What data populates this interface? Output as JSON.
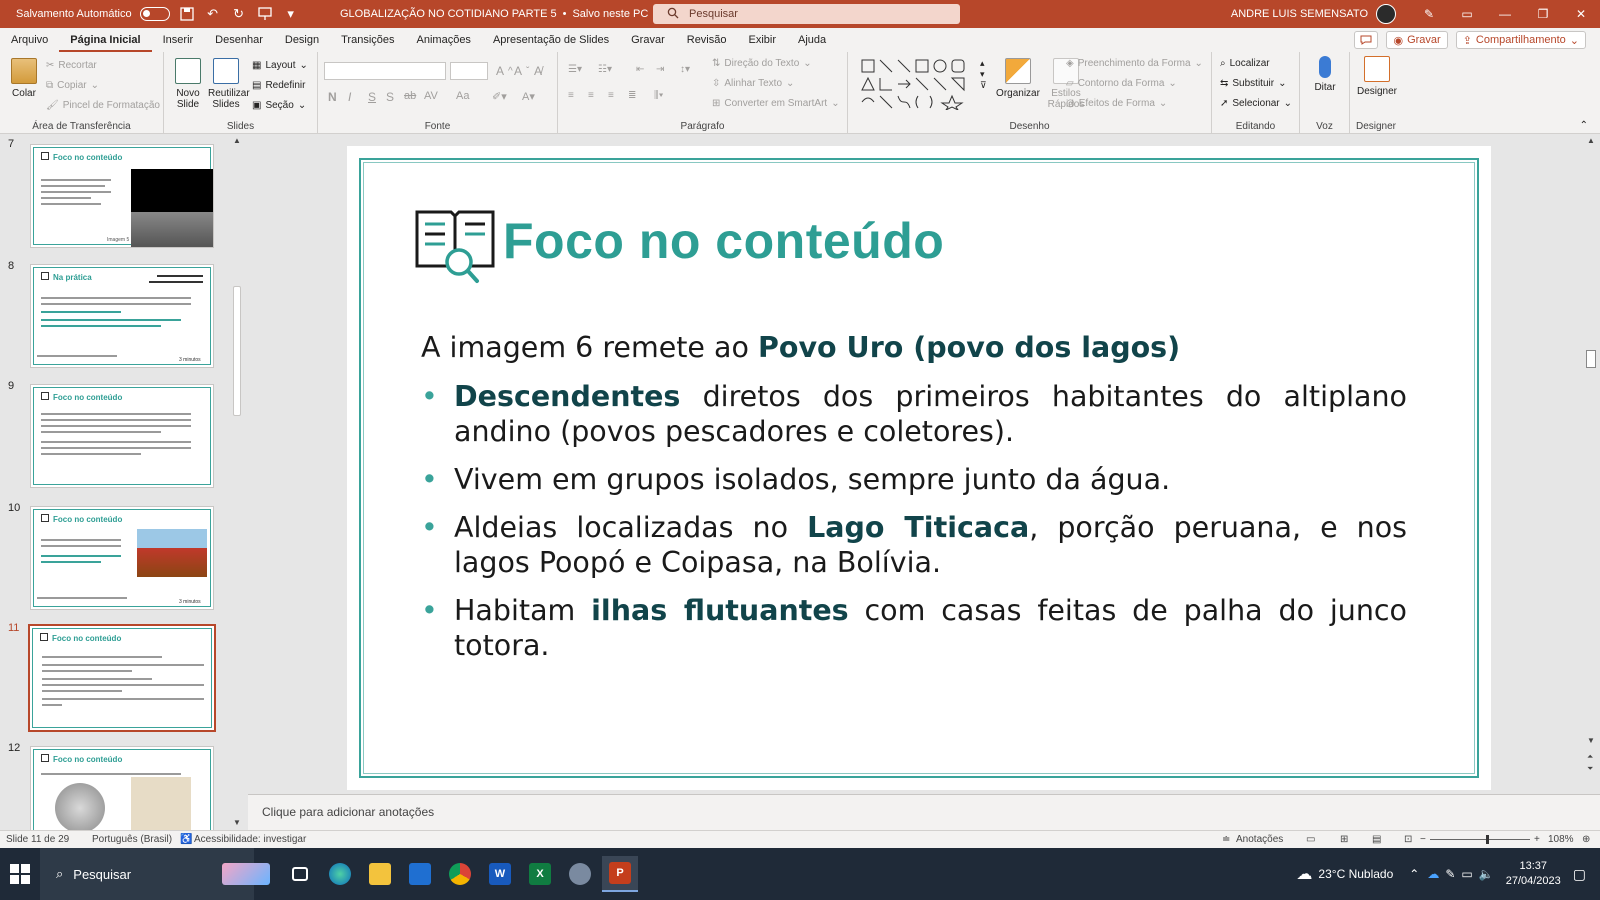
{
  "window": {
    "autosave_label": "Salvamento Automático",
    "doc_title": "GLOBALIZAÇÃO NO COTIDIANO PARTE 5",
    "save_status": "Salvo neste PC",
    "search_placeholder": "Pesquisar",
    "user_name": "ANDRE LUIS SEMENSATO"
  },
  "menu": {
    "tabs": [
      "Arquivo",
      "Página Inicial",
      "Inserir",
      "Desenhar",
      "Design",
      "Transições",
      "Animações",
      "Apresentação de Slides",
      "Gravar",
      "Revisão",
      "Exibir",
      "Ajuda"
    ],
    "active_tab": "Página Inicial",
    "record_label": "Gravar",
    "share_label": "Compartilhamento"
  },
  "ribbon": {
    "clipboard": {
      "label": "Área de Transferência",
      "paste": "Colar",
      "cut": "Recortar",
      "copy": "Copiar",
      "format_painter": "Pincel de Formatação"
    },
    "slides": {
      "label": "Slides",
      "new_slide": "Novo Slide",
      "reuse_slides": "Reutilizar Slides",
      "layout": "Layout",
      "reset": "Redefinir",
      "section": "Seção"
    },
    "font": {
      "label": "Fonte",
      "bold": "N",
      "italic": "I",
      "underline": "S",
      "shadow": "S",
      "strike": "ab",
      "spacing": "AV",
      "case": "Aa"
    },
    "paragraph": {
      "label": "Parágrafo",
      "text_direction": "Direção do Texto",
      "align_text": "Alinhar Texto",
      "convert_smartart": "Converter em SmartArt"
    },
    "drawing": {
      "label": "Desenho",
      "arrange": "Organizar",
      "quick_styles": "Estilos Rápidos",
      "shape_fill": "Preenchimento da Forma",
      "shape_outline": "Contorno da Forma",
      "shape_effects": "Efeitos de Forma"
    },
    "editing": {
      "label": "Editando",
      "find": "Localizar",
      "replace": "Substituir",
      "select": "Selecionar"
    },
    "voice": {
      "label": "Voz",
      "dictate": "Ditar"
    },
    "designer": {
      "label": "Designer",
      "designer": "Designer"
    }
  },
  "thumbnails": [
    {
      "number": "7",
      "title": "Foco no conteúdo",
      "caption": "Imagem 5"
    },
    {
      "number": "8",
      "title": "Na prática",
      "caption": "3 minutos"
    },
    {
      "number": "9",
      "title": "Foco no conteúdo",
      "caption": ""
    },
    {
      "number": "10",
      "title": "Foco no conteúdo",
      "caption": "3 minutos"
    },
    {
      "number": "11",
      "title": "Foco no conteúdo",
      "caption": ""
    },
    {
      "number": "12",
      "title": "Foco no conteúdo",
      "caption": ""
    }
  ],
  "active_thumbnail": "11",
  "slide": {
    "title": "Foco no conteúdo",
    "lead_prefix": "A imagem 6 remete ao ",
    "lead_strong": "Povo Uro (povo dos lagos)",
    "bullets": [
      {
        "strong": "Descendentes",
        "text": " diretos dos primeiros habitantes do altiplano andino (povos pescadores e coletores)."
      },
      {
        "text": "Vivem em grupos isolados, sempre junto da água."
      },
      {
        "pre": "Aldeias localizadas no ",
        "strong": "Lago Titicaca",
        "text": ", porção peruana, e nos lagos Poopó e Coipasa, na Bolívia."
      },
      {
        "pre": "Habitam ",
        "strong": "ilhas flutuantes",
        "text": " com casas feitas de palha do junco totora."
      }
    ]
  },
  "notes_placeholder": "Clique para adicionar anotações",
  "status": {
    "slide_counter": "Slide 11 de 29",
    "language": "Português (Brasil)",
    "accessibility": "Acessibilidade: investigar",
    "notes_label": "Anotações",
    "zoom": "108%"
  },
  "taskbar": {
    "search_label": "Pesquisar",
    "weather": "23°C  Nublado",
    "time": "13:37",
    "date": "27/04/2023"
  },
  "colors": {
    "accent": "#b7472a",
    "teal": "#2e9e94",
    "dark_teal": "#11444a"
  }
}
